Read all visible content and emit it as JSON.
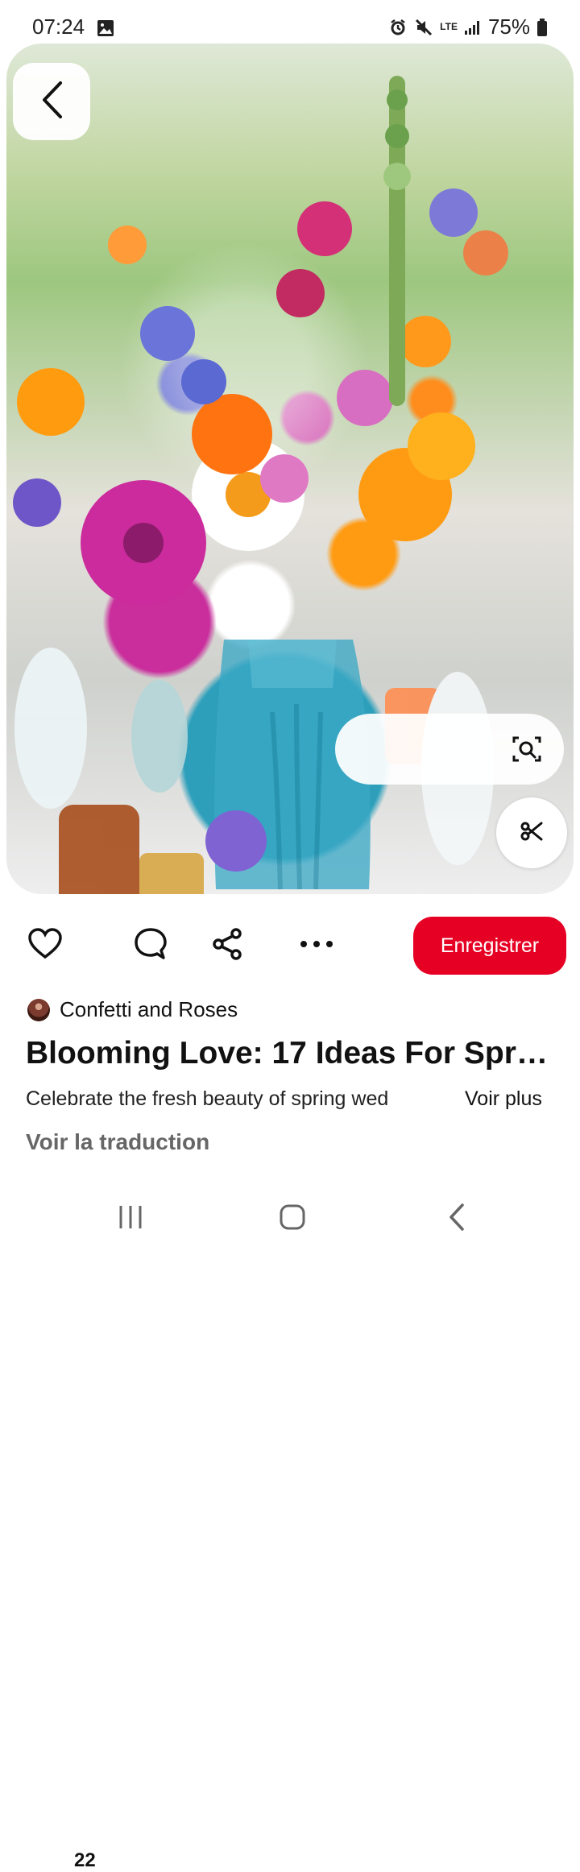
{
  "status_bar": {
    "time": "07:24",
    "network": "LTE",
    "battery": "75%"
  },
  "pin": {
    "image_alt": "Wildflower centerpiece in blue vase",
    "like_count": "22",
    "save_label": "Enregistrer",
    "creator": "Confetti and Roses",
    "title": "Blooming Love: 17 Ideas For Sprin...",
    "description": "Celebrate the fresh beauty of spring wed",
    "see_more": "Voir plus",
    "translate": "Voir la traduction"
  },
  "icons": {
    "back": "chevron-left-icon",
    "lens": "visual-search-icon",
    "scissors": "scissors-icon",
    "like": "heart-icon",
    "comment": "comment-icon",
    "share": "share-icon",
    "more": "more-icon",
    "nav_recent": "recent-apps-icon",
    "nav_home": "home-icon",
    "nav_back": "nav-back-icon"
  },
  "colors": {
    "save_button": "#e60023",
    "text": "#111111",
    "muted": "#666666"
  }
}
